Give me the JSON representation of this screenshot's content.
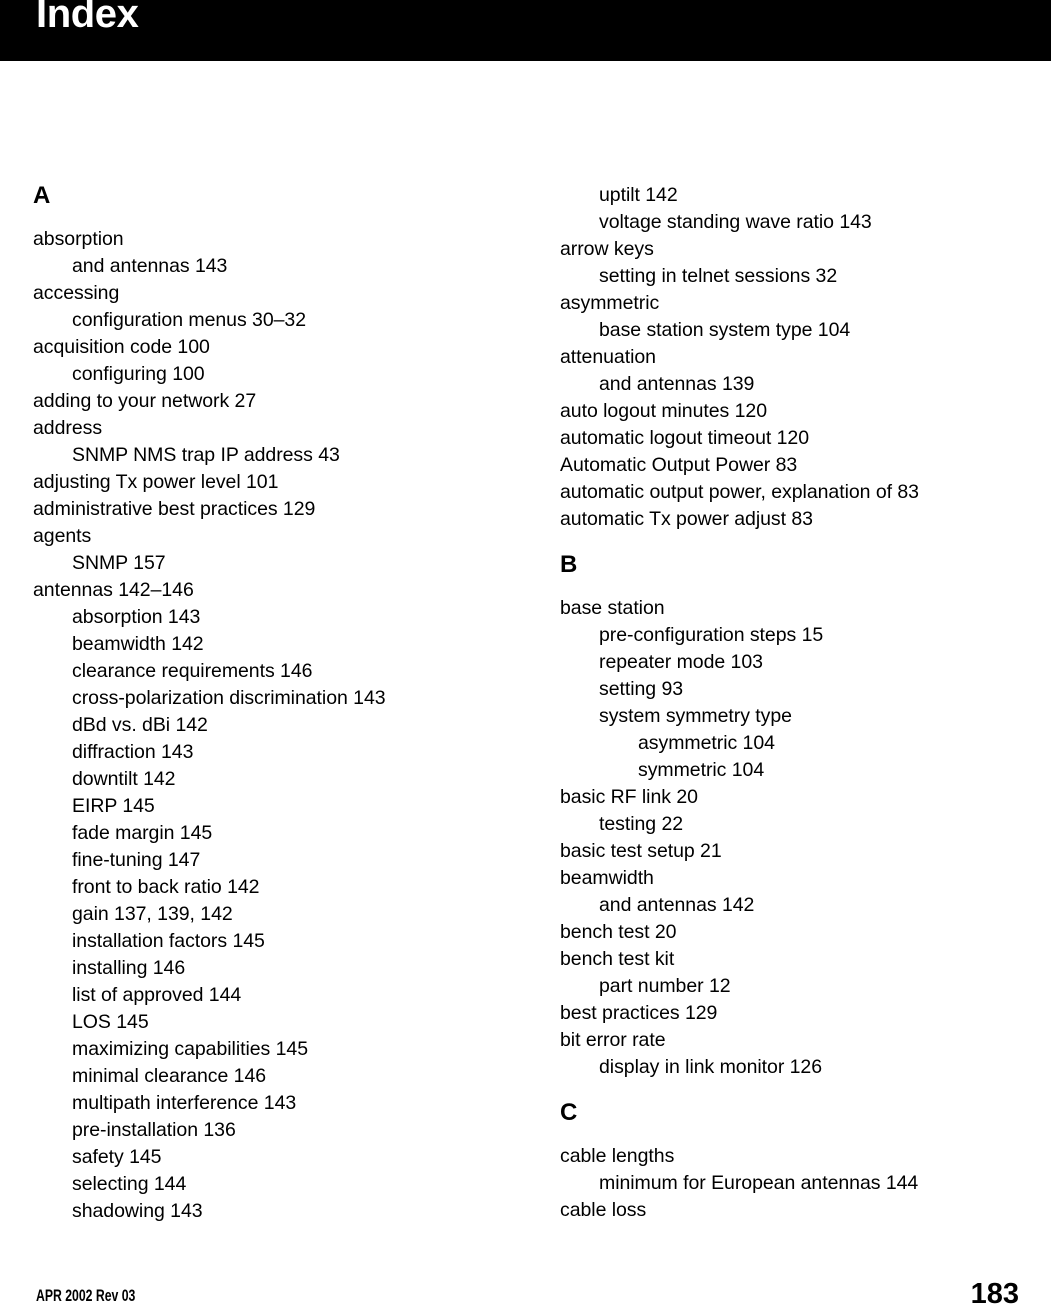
{
  "header": {
    "title": "Index"
  },
  "footer": {
    "revision": "APR 2002 Rev 03",
    "page_number": "183"
  },
  "columns": [
    {
      "name": "left-column",
      "blocks": [
        {
          "heading": "A",
          "entries": [
            {
              "level": 0,
              "text": "absorption"
            },
            {
              "level": 1,
              "text": "and antennas 143"
            },
            {
              "level": 0,
              "text": "accessing"
            },
            {
              "level": 1,
              "text": "configuration menus 30–32"
            },
            {
              "level": 0,
              "text": "acquisition code 100"
            },
            {
              "level": 1,
              "text": "configuring 100"
            },
            {
              "level": 0,
              "text": "adding to your network 27"
            },
            {
              "level": 0,
              "text": "address"
            },
            {
              "level": 1,
              "text": "SNMP NMS trap IP address 43"
            },
            {
              "level": 0,
              "text": "adjusting Tx power level 101"
            },
            {
              "level": 0,
              "text": "administrative best practices 129"
            },
            {
              "level": 0,
              "text": "agents"
            },
            {
              "level": 1,
              "text": "SNMP 157"
            },
            {
              "level": 0,
              "text": "antennas 142–146"
            },
            {
              "level": 1,
              "text": "absorption 143"
            },
            {
              "level": 1,
              "text": "beamwidth 142"
            },
            {
              "level": 1,
              "text": "clearance requirements 146"
            },
            {
              "level": 1,
              "text": "cross-polarization discrimination 143"
            },
            {
              "level": 1,
              "text": "dBd vs. dBi 142"
            },
            {
              "level": 1,
              "text": "diffraction 143"
            },
            {
              "level": 1,
              "text": "downtilt 142"
            },
            {
              "level": 1,
              "text": "EIRP 145"
            },
            {
              "level": 1,
              "text": "fade margin 145"
            },
            {
              "level": 1,
              "text": "fine-tuning 147"
            },
            {
              "level": 1,
              "text": "front to back ratio 142"
            },
            {
              "level": 1,
              "text": "gain 137, 139, 142"
            },
            {
              "level": 1,
              "text": "installation factors 145"
            },
            {
              "level": 1,
              "text": "installing 146"
            },
            {
              "level": 1,
              "text": "list of approved 144"
            },
            {
              "level": 1,
              "text": "LOS 145"
            },
            {
              "level": 1,
              "text": "maximizing capabilities 145"
            },
            {
              "level": 1,
              "text": "minimal clearance 146"
            },
            {
              "level": 1,
              "text": "multipath interference 143"
            },
            {
              "level": 1,
              "text": "pre-installation 136"
            },
            {
              "level": 1,
              "text": "safety 145"
            },
            {
              "level": 1,
              "text": "selecting 144"
            },
            {
              "level": 1,
              "text": "shadowing 143"
            }
          ]
        }
      ]
    },
    {
      "name": "right-column",
      "blocks": [
        {
          "heading": null,
          "entries": [
            {
              "level": 1,
              "text": "uptilt 142"
            },
            {
              "level": 1,
              "text": "voltage standing wave ratio 143"
            },
            {
              "level": 0,
              "text": "arrow keys"
            },
            {
              "level": 1,
              "text": "setting in telnet sessions 32"
            },
            {
              "level": 0,
              "text": "asymmetric"
            },
            {
              "level": 1,
              "text": "base station system type 104"
            },
            {
              "level": 0,
              "text": "attenuation"
            },
            {
              "level": 1,
              "text": "and antennas 139"
            },
            {
              "level": 0,
              "text": "auto logout minutes 120"
            },
            {
              "level": 0,
              "text": "automatic logout timeout 120"
            },
            {
              "level": 0,
              "text": "Automatic Output Power 83"
            },
            {
              "level": 0,
              "text": "automatic output power, explanation of 83"
            },
            {
              "level": 0,
              "text": "automatic Tx power adjust 83"
            }
          ]
        },
        {
          "heading": "B",
          "entries": [
            {
              "level": 0,
              "text": "base station"
            },
            {
              "level": 1,
              "text": "pre-configuration steps 15"
            },
            {
              "level": 1,
              "text": "repeater mode 103"
            },
            {
              "level": 1,
              "text": "setting 93"
            },
            {
              "level": 1,
              "text": "system symmetry type"
            },
            {
              "level": 2,
              "text": "asymmetric 104"
            },
            {
              "level": 2,
              "text": "symmetric 104"
            },
            {
              "level": 0,
              "text": "basic RF link 20"
            },
            {
              "level": 1,
              "text": "testing 22"
            },
            {
              "level": 0,
              "text": "basic test setup 21"
            },
            {
              "level": 0,
              "text": "beamwidth"
            },
            {
              "level": 1,
              "text": "and antennas 142"
            },
            {
              "level": 0,
              "text": "bench test 20"
            },
            {
              "level": 0,
              "text": "bench test kit"
            },
            {
              "level": 1,
              "text": "part number 12"
            },
            {
              "level": 0,
              "text": "best practices 129"
            },
            {
              "level": 0,
              "text": "bit error rate"
            },
            {
              "level": 1,
              "text": "display in link monitor 126"
            }
          ]
        },
        {
          "heading": "C",
          "entries": [
            {
              "level": 0,
              "text": "cable lengths"
            },
            {
              "level": 1,
              "text": "minimum for European antennas 144"
            },
            {
              "level": 0,
              "text": "cable loss"
            }
          ]
        }
      ]
    }
  ]
}
